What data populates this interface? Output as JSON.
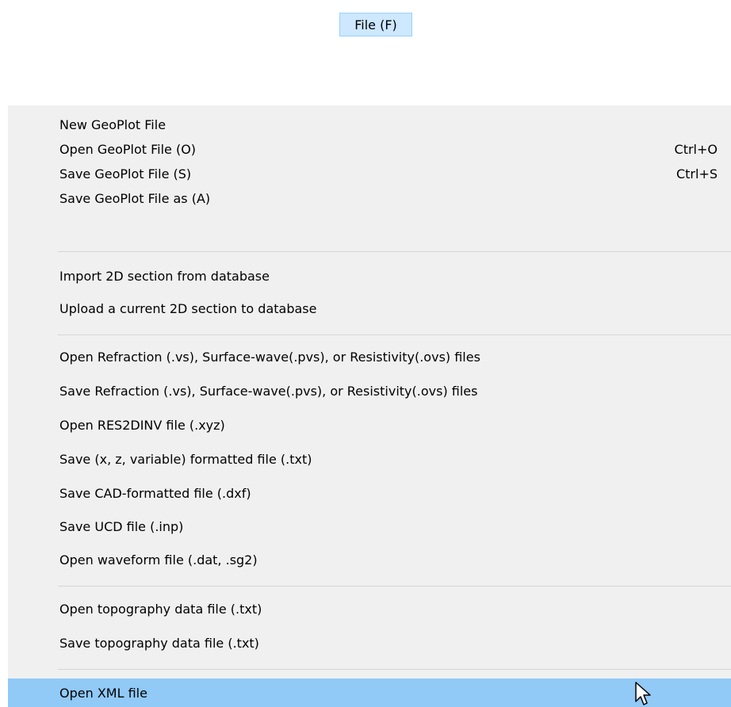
{
  "menubar": {
    "file_label": "File (F)"
  },
  "menu": {
    "items": [
      {
        "label": "New GeoPlot File",
        "shortcut": ""
      },
      {
        "label": "Open GeoPlot File (O)",
        "shortcut": "Ctrl+O"
      },
      {
        "label": "Save GeoPlot File (S)",
        "shortcut": "Ctrl+S"
      },
      {
        "label": "Save GeoPlot File as (A)",
        "shortcut": ""
      },
      {
        "label": "Import 2D section from database",
        "shortcut": ""
      },
      {
        "label": "Upload a current 2D section to database",
        "shortcut": ""
      },
      {
        "label": "Open Refraction (.vs), Surface-wave(.pvs), or Resistivity(.ovs) files",
        "shortcut": ""
      },
      {
        "label": "Save Refraction (.vs), Surface-wave(.pvs), or Resistivity(.ovs) files",
        "shortcut": ""
      },
      {
        "label": "Open RES2DINV file (.xyz)",
        "shortcut": ""
      },
      {
        "label": "Save (x, z, variable) formatted file (.txt)",
        "shortcut": ""
      },
      {
        "label": "Save CAD-formatted file (.dxf)",
        "shortcut": ""
      },
      {
        "label": "Save UCD file (.inp)",
        "shortcut": ""
      },
      {
        "label": "Open waveform file (.dat, .sg2)",
        "shortcut": ""
      },
      {
        "label": "Open topography data file (.txt)",
        "shortcut": ""
      },
      {
        "label": "Save topography data file (.txt)",
        "shortcut": ""
      },
      {
        "label": "Open XML file",
        "shortcut": "",
        "highlighted": true
      }
    ]
  },
  "colors": {
    "menu_background": "#f0f0f0",
    "highlight": "#91c9f7",
    "menubar_active": "#cde8ff"
  }
}
